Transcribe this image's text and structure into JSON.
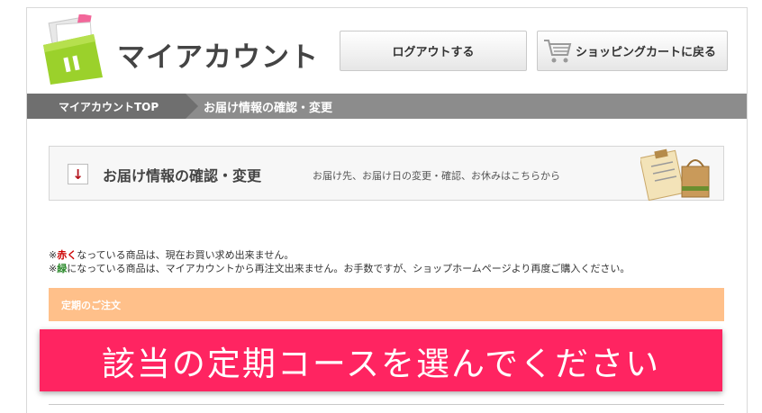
{
  "header": {
    "title": "マイアカウント",
    "logout_label": "ログアウトする",
    "cart_label": "ショッピングカートに戻る"
  },
  "breadcrumb": {
    "items": [
      "マイアカウントTOP",
      "お届け情報の確認・変更"
    ]
  },
  "info": {
    "title": "お届け情報の確認・変更",
    "subtitle": "お届け先、お届け日の変更・確認、お休みはこちらから"
  },
  "notes": {
    "line1_prefix": "※",
    "line1_colored": "赤く",
    "line1_rest": "なっている商品は、現在お買い求め出来ません。",
    "line2_prefix": "※",
    "line2_colored": "緑",
    "line2_rest": "になっている商品は、マイアカウントから再注文出来ません。お手数ですが、ショップホームページより再度ご購入ください。"
  },
  "section": {
    "teiki_label": "定期のご注文"
  },
  "banner": {
    "text": "該当の定期コースを選んでください"
  },
  "colors": {
    "banner": "#ff2461",
    "teiki": "#ffc08a",
    "breadcrumb_dark": "#6f6f6f",
    "breadcrumb_light": "#8c8c8c",
    "red_note": "#cc0000",
    "green_note": "#2e8b2e"
  },
  "icons": {
    "logo": "folder-icon",
    "cart": "shopping-cart-icon",
    "arrow": "arrow-down-icon",
    "clipboard": "clipboard-bag-icon"
  }
}
